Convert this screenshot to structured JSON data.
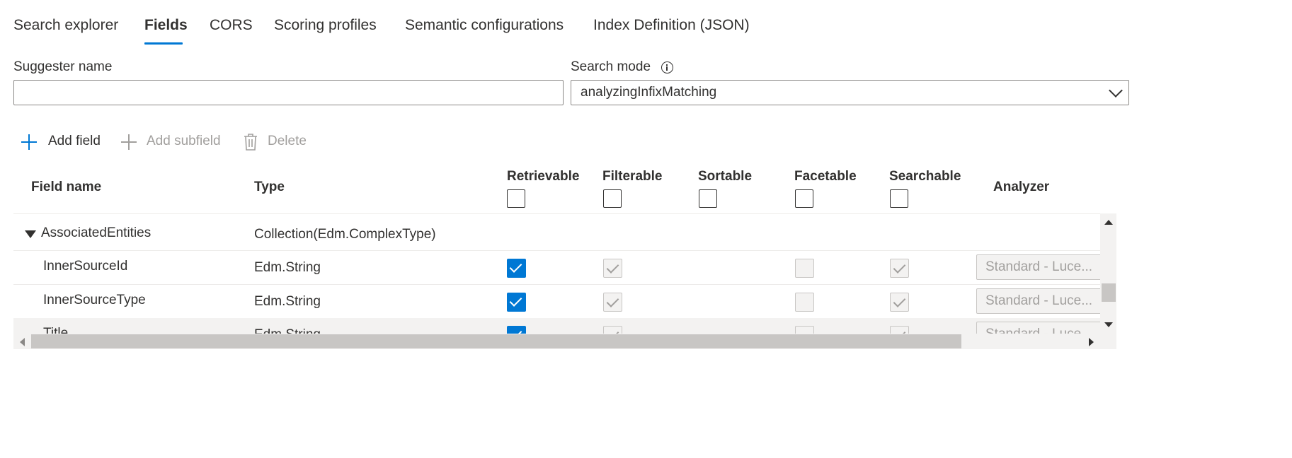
{
  "tabs": [
    {
      "label": "Search explorer",
      "selected": false
    },
    {
      "label": "Fields",
      "selected": true
    },
    {
      "label": "CORS",
      "selected": false
    },
    {
      "label": "Scoring profiles",
      "selected": false
    },
    {
      "label": "Semantic configurations",
      "selected": false
    },
    {
      "label": "Index Definition (JSON)",
      "selected": false
    }
  ],
  "suggester": {
    "label": "Suggester name",
    "value": "",
    "placeholder": ""
  },
  "search_mode": {
    "label": "Search mode",
    "value": "analyzingInfixMatching"
  },
  "toolbar": {
    "add_field": "Add field",
    "add_subfield": "Add subfield",
    "delete": "Delete"
  },
  "grid": {
    "columns": {
      "field_name": "Field name",
      "type": "Type",
      "retrievable": "Retrievable",
      "filterable": "Filterable",
      "sortable": "Sortable",
      "facetable": "Facetable",
      "searchable": "Searchable",
      "analyzer": "Analyzer"
    },
    "rows": [
      {
        "name": "AssociatedEntities",
        "type": "Collection(Edm.ComplexType)",
        "expanded": true
      },
      {
        "name": "InnerSourceId",
        "type": "Edm.String",
        "retrievable": true,
        "filterable": true,
        "facetable": false,
        "searchable": true,
        "analyzer": "Standard - Luce..."
      },
      {
        "name": "InnerSourceType",
        "type": "Edm.String",
        "retrievable": true,
        "filterable": true,
        "facetable": false,
        "searchable": true,
        "analyzer": "Standard - Luce..."
      },
      {
        "name": "Title",
        "type": "Edm.String",
        "retrievable": true,
        "filterable": true,
        "facetable": false,
        "searchable": true,
        "analyzer": "Standard - Luce..."
      }
    ]
  },
  "colors": {
    "accent": "#0078d4",
    "text": "#323130",
    "disabled_text": "#a19f9d",
    "row_hover": "#f3f2f1"
  }
}
